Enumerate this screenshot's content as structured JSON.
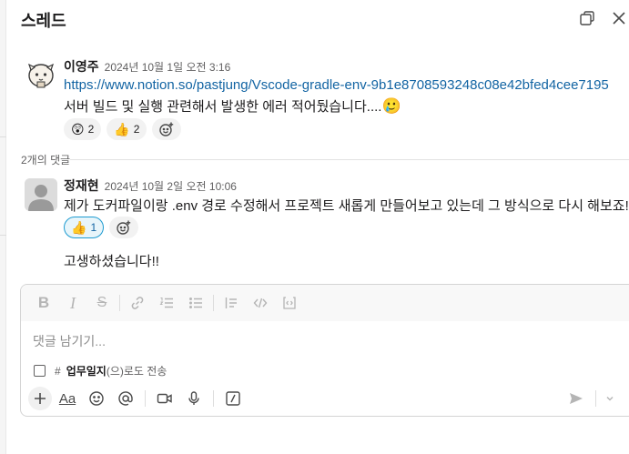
{
  "thread": {
    "title": "스레드"
  },
  "parent_message": {
    "author": "이영주",
    "timestamp": "2024년 10월 1일 오전 3:16",
    "link": "https://www.notion.so/pastjung/Vscode-gradle-env-9b1e8708593248c08e42bfed4cee7195",
    "text": "서버 빌드 및 실행 관련해서 발생한 에러 적어뒀습니다....",
    "text_emoji": "🥲",
    "reactions": [
      {
        "emoji": "😲",
        "count": "2"
      },
      {
        "emoji": "👍",
        "count": "2"
      }
    ]
  },
  "replies": {
    "count_label": "2개의 댓글",
    "items": [
      {
        "author": "정재현",
        "timestamp": "2024년 10월 2일 오전 10:06",
        "text": "제가 도커파일이랑 .env 경로 수정해서 프로젝트 새롭게 만들어보고 있는데 그 방식으로 다시 해보죠!",
        "reactions": [
          {
            "emoji": "👍",
            "count": "1"
          }
        ]
      },
      {
        "text": "고생하셨습니다!!"
      }
    ]
  },
  "composer": {
    "placeholder": "댓글 남기기...",
    "also_send_hash": "#",
    "also_send_channel": "업무일지",
    "also_send_suffix": "(으)로도 전송"
  },
  "colors": {
    "link": "#1264a3",
    "active_reaction_border": "#1d9bd1",
    "active_reaction_bg": "#e8f5fa"
  }
}
